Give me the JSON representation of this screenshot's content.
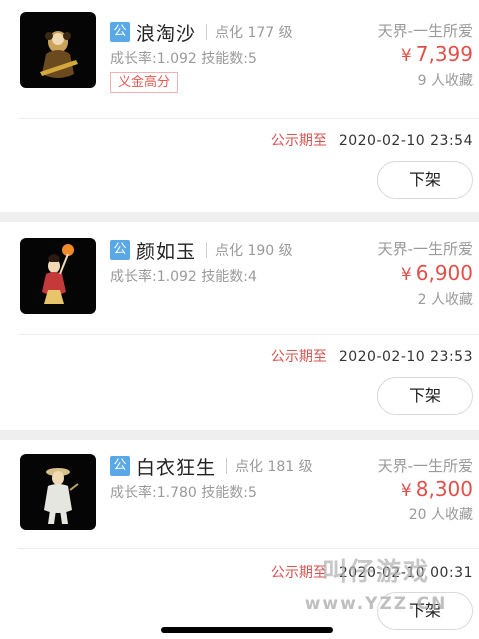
{
  "listings": [
    {
      "badge": "公",
      "name": "浪淘沙",
      "level": "点化 177 级",
      "stats": "成长率:1.092 技能数:5",
      "tag": "义金高分",
      "server": "天界-一生所爱",
      "currency": "¥",
      "price": "7,399",
      "favorites": "9 人收藏",
      "deadline_label": "公示期至",
      "deadline_time": "2020-02-10 23:54",
      "action_label": "下架",
      "thumb_icon": "character-portrait-icon"
    },
    {
      "badge": "公",
      "name": "颜如玉",
      "level": "点化 190 级",
      "stats": "成长率:1.092 技能数:4",
      "server": "天界-一生所爱",
      "currency": "¥",
      "price": "6,900",
      "favorites": "2 人收藏",
      "deadline_label": "公示期至",
      "deadline_time": "2020-02-10 23:53",
      "action_label": "下架",
      "thumb_icon": "character-portrait-icon"
    },
    {
      "badge": "公",
      "name": "白衣狂生",
      "level": "点化 181 级",
      "stats": "成长率:1.780 技能数:5",
      "server": "天界-一生所爱",
      "currency": "¥",
      "price": "8,300",
      "favorites": "20 人收藏",
      "deadline_label": "公示期至",
      "deadline_time": "2020-02-10 00:31",
      "action_label": "下架",
      "thumb_icon": "character-portrait-icon"
    }
  ],
  "watermark": {
    "logo": "叫仔游戏",
    "url": "www.YZZ.CN"
  },
  "colors": {
    "price": "#e24f49",
    "badge": "#5aa9e6",
    "deadline_label": "#d9534f",
    "tag_border": "#f2b3b0"
  }
}
